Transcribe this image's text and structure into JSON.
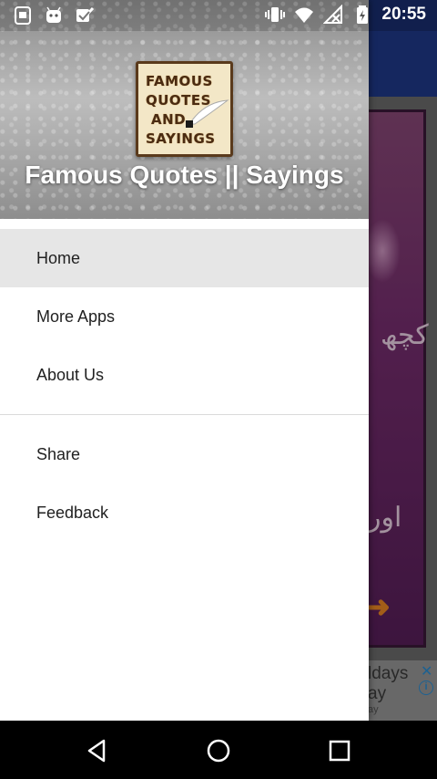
{
  "status_bar": {
    "time": "20:55",
    "left_icons": [
      "screenshot-icon",
      "android-icon",
      "checkbox-icon"
    ],
    "right_icons": [
      "vibrate-icon",
      "wifi-icon",
      "no-signal-icon",
      "battery-icon"
    ]
  },
  "background_app": {
    "ad": {
      "text_line1": "ldays",
      "text_line2": "ay",
      "sub": "ay"
    },
    "accent_colors": {
      "appbar": "#1f3a8c",
      "card": "#7a2f72",
      "arrow": "#f08a24"
    }
  },
  "drawer": {
    "logo": {
      "line1": "FAMOUS",
      "line2": "QUOTES",
      "line3": "AND",
      "line4": "SAYINGS"
    },
    "title": "Famous Quotes || Sayings",
    "menu": [
      {
        "label": "Home",
        "active": true
      },
      {
        "label": "More Apps"
      },
      {
        "label": "About Us"
      },
      {
        "label": "Share"
      },
      {
        "label": "Feedback"
      }
    ]
  },
  "nav_bar": {
    "buttons": [
      "back-icon",
      "home-icon",
      "recents-icon"
    ]
  }
}
